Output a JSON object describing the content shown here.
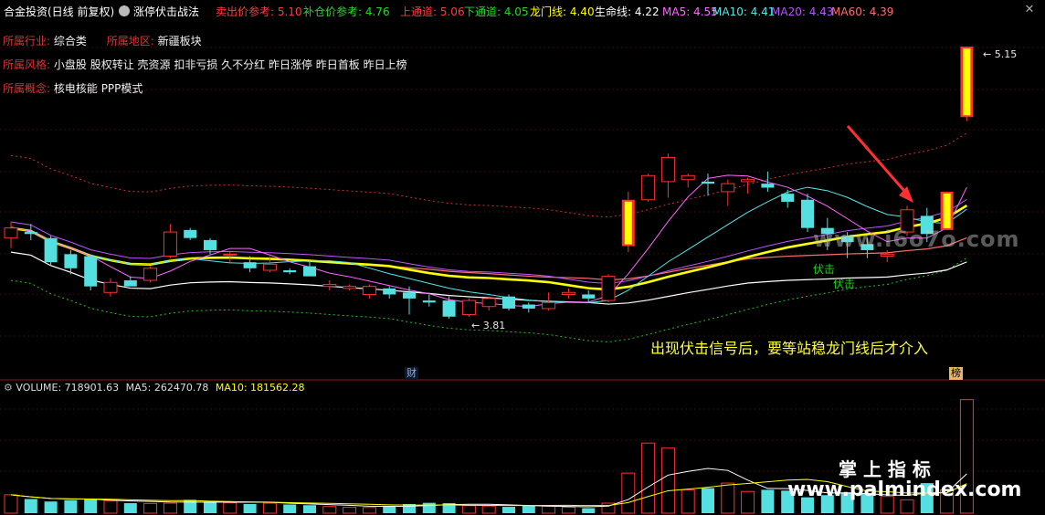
{
  "header": {
    "title": "合金投资(日线 前复权)",
    "strategy": "涨停伏击战法",
    "items": [
      {
        "label": "卖出价参考: 5.10",
        "color": "#ff3b3b"
      },
      {
        "label": "补仓价参考: 4.76",
        "color": "#22dd22"
      },
      {
        "label": "上通道: 5.06",
        "color": "#ff3b3b"
      },
      {
        "label": "下通道: 4.05",
        "color": "#22dd22"
      },
      {
        "label": "龙门线: 4.40",
        "color": "#ffff00"
      },
      {
        "label": "生命线: 4.22",
        "color": "#ffffff"
      },
      {
        "label": "MA5: 4.55",
        "color": "#ff66ff"
      },
      {
        "label": "MA10: 4.41",
        "color": "#55e5e5"
      },
      {
        "label": "MA20: 4.43",
        "color": "#bb55ff"
      },
      {
        "label": "MA60: 4.39",
        "color": "#ff6e6e"
      }
    ]
  },
  "info": {
    "industry_label": "所属行业:",
    "industry_value": "综合类",
    "region_label": "所属地区:",
    "region_value": "新疆板块",
    "style_label": "所属风格:",
    "style_value": "小盘股 股权转让 壳资源 扣非亏损 久不分红 昨日涨停 昨日首板 昨日上榜",
    "concept_label": "所属概念:",
    "concept_value": "核电核能 PPP模式"
  },
  "annotation": "出现伏击信号后，要等站稳龙门线后才介入",
  "signals": [
    "伏击",
    "伏击"
  ],
  "price_labels": {
    "high": "5.15",
    "low": "3.81"
  },
  "markers": {
    "cai": "财",
    "bang": "榜"
  },
  "watermark_top": "www.i6o7o.com",
  "watermark_brand": "掌 上 指 标",
  "watermark_url": "www.palmindex.com",
  "volume": {
    "label": "VOLUME: 718901.63",
    "ma5": "MA5: 262470.78",
    "ma10": "MA10: 181562.28"
  },
  "colors": {
    "up": "#ff3030",
    "down": "#54e0e0",
    "longmen": "#ffff00",
    "life": "#ffffff",
    "ma5": "#ff66ff",
    "ma10": "#55e5e5",
    "ma20": "#bb55ff",
    "ma60": "#ff6e6e",
    "channel_up": "#d03030",
    "channel_down": "#20c020"
  },
  "chart_data": {
    "type": "candlestick",
    "price_range": [
      3.75,
      5.2
    ],
    "candles": [
      {
        "o": 4.2,
        "h": 4.28,
        "l": 4.15,
        "c": 4.25
      },
      {
        "o": 4.23,
        "h": 4.27,
        "l": 4.19,
        "c": 4.22
      },
      {
        "o": 4.2,
        "h": 4.21,
        "l": 4.06,
        "c": 4.08
      },
      {
        "o": 4.12,
        "h": 4.14,
        "l": 4.02,
        "c": 4.05
      },
      {
        "o": 4.11,
        "h": 4.12,
        "l": 3.94,
        "c": 3.96
      },
      {
        "o": 3.93,
        "h": 4.0,
        "l": 3.91,
        "c": 3.98
      },
      {
        "o": 3.99,
        "h": 4.01,
        "l": 3.96,
        "c": 3.96
      },
      {
        "o": 3.99,
        "h": 4.06,
        "l": 3.98,
        "c": 4.05
      },
      {
        "o": 4.11,
        "h": 4.27,
        "l": 4.1,
        "c": 4.23
      },
      {
        "o": 4.24,
        "h": 4.25,
        "l": 4.19,
        "c": 4.2
      },
      {
        "o": 4.19,
        "h": 4.2,
        "l": 4.12,
        "c": 4.14
      },
      {
        "o": 4.12,
        "h": 4.13,
        "l": 4.08,
        "c": 4.12
      },
      {
        "o": 4.08,
        "h": 4.11,
        "l": 4.03,
        "c": 4.05
      },
      {
        "o": 4.04,
        "h": 4.11,
        "l": 4.03,
        "c": 4.07
      },
      {
        "o": 4.04,
        "h": 4.05,
        "l": 4.02,
        "c": 4.03
      },
      {
        "o": 4.06,
        "h": 4.09,
        "l": 4.02,
        "c": 4.01
      },
      {
        "o": 3.96,
        "h": 3.99,
        "l": 3.94,
        "c": 3.97
      },
      {
        "o": 3.95,
        "h": 3.97,
        "l": 3.94,
        "c": 3.96
      },
      {
        "o": 3.92,
        "h": 3.97,
        "l": 3.9,
        "c": 3.96
      },
      {
        "o": 3.95,
        "h": 3.96,
        "l": 3.9,
        "c": 3.92
      },
      {
        "o": 3.93,
        "h": 3.96,
        "l": 3.82,
        "c": 3.9
      },
      {
        "o": 3.89,
        "h": 3.92,
        "l": 3.86,
        "c": 3.88
      },
      {
        "o": 3.89,
        "h": 3.91,
        "l": 3.8,
        "c": 3.81
      },
      {
        "o": 3.82,
        "h": 3.9,
        "l": 3.81,
        "c": 3.89
      },
      {
        "o": 3.86,
        "h": 3.91,
        "l": 3.84,
        "c": 3.9
      },
      {
        "o": 3.91,
        "h": 3.92,
        "l": 3.84,
        "c": 3.85
      },
      {
        "o": 3.87,
        "h": 3.88,
        "l": 3.83,
        "c": 3.85
      },
      {
        "o": 3.85,
        "h": 3.93,
        "l": 3.84,
        "c": 3.88
      },
      {
        "o": 3.92,
        "h": 3.95,
        "l": 3.9,
        "c": 3.93
      },
      {
        "o": 3.92,
        "h": 3.94,
        "l": 3.88,
        "c": 3.9
      },
      {
        "o": 3.89,
        "h": 4.02,
        "l": 3.88,
        "c": 4.01
      },
      {
        "o": 4.16,
        "h": 4.43,
        "l": 4.13,
        "c": 4.39
      },
      {
        "o": 4.39,
        "h": 4.52,
        "l": 4.38,
        "c": 4.51
      },
      {
        "o": 4.48,
        "h": 4.62,
        "l": 4.4,
        "c": 4.6
      },
      {
        "o": 4.49,
        "h": 4.52,
        "l": 4.45,
        "c": 4.51
      },
      {
        "o": 4.48,
        "h": 4.52,
        "l": 4.41,
        "c": 4.47
      },
      {
        "o": 4.43,
        "h": 4.49,
        "l": 4.36,
        "c": 4.47
      },
      {
        "o": 4.48,
        "h": 4.5,
        "l": 4.42,
        "c": 4.49
      },
      {
        "o": 4.47,
        "h": 4.53,
        "l": 4.43,
        "c": 4.45
      },
      {
        "o": 4.42,
        "h": 4.44,
        "l": 4.35,
        "c": 4.38
      },
      {
        "o": 4.39,
        "h": 4.42,
        "l": 4.23,
        "c": 4.25
      },
      {
        "o": 4.25,
        "h": 4.3,
        "l": 4.14,
        "c": 4.22
      },
      {
        "o": 4.21,
        "h": 4.23,
        "l": 4.1,
        "c": 4.18
      },
      {
        "o": 4.17,
        "h": 4.2,
        "l": 4.1,
        "c": 4.14
      },
      {
        "o": 4.11,
        "h": 4.14,
        "l": 4.08,
        "c": 4.12
      },
      {
        "o": 4.23,
        "h": 4.36,
        "l": 4.21,
        "c": 4.34
      },
      {
        "o": 4.31,
        "h": 4.35,
        "l": 4.18,
        "c": 4.22
      },
      {
        "o": 4.24,
        "h": 4.43,
        "l": 4.24,
        "c": 4.43
      },
      {
        "o": 4.8,
        "h": 5.15,
        "l": 4.78,
        "c": 5.15
      }
    ],
    "volume_max": 718901.63,
    "volumes": [
      110,
      85,
      70,
      78,
      82,
      75,
      60,
      58,
      60,
      80,
      70,
      62,
      55,
      60,
      52,
      48,
      40,
      35,
      34,
      44,
      55,
      62,
      60,
      45,
      43,
      38,
      44,
      42,
      36,
      30,
      60,
      240,
      420,
      390,
      140,
      150,
      180,
      130,
      140,
      135,
      95,
      108,
      125,
      120,
      100,
      80,
      180,
      140,
      680
    ]
  }
}
